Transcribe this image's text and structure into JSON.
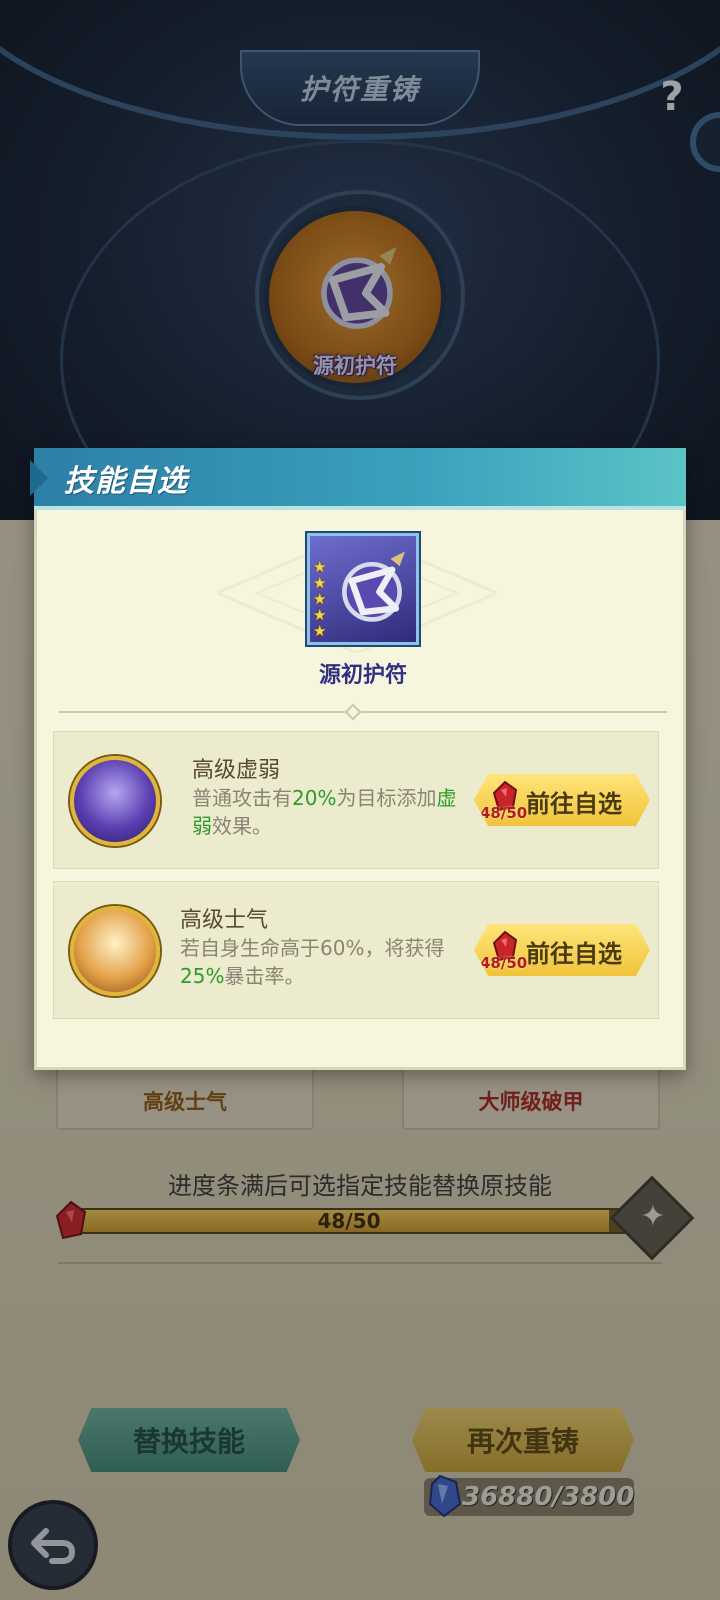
{
  "header": {
    "title": "护符重铸",
    "help_label": "?"
  },
  "amulet": {
    "name": "源初护符"
  },
  "background_cards": {
    "left_label": "高级士气",
    "right_label": "大师级破甲"
  },
  "progress": {
    "caption": "进度条满后可选指定技能替换原技能",
    "current": 48,
    "max": 50,
    "text": "48/50"
  },
  "actions": {
    "replace_label": "替换技能",
    "recast_label": "再次重铸",
    "cost_text": "36880/3800"
  },
  "modal": {
    "title": "技能自选",
    "item_name": "源初护符",
    "item_stars": 5,
    "skills": [
      {
        "name": "高级虚弱",
        "desc_prefix": "普通攻击有",
        "desc_hl1": "20%",
        "desc_mid": "为目标添加",
        "desc_hl2": "虚弱",
        "desc_suffix": "效果。",
        "button_label": "前往自选",
        "count": "48/50"
      },
      {
        "name": "高级士气",
        "desc_prefix": "若自身生命高于60%，将获得",
        "desc_hl1": "25%",
        "desc_suffix": "暴击率。",
        "button_label": "前往自选",
        "count": "48/50"
      }
    ]
  },
  "colors": {
    "modal_header": "#3aa2bc",
    "highlight_green": "#2e9b2a",
    "button_gold": "#f0c43a",
    "button_teal": "#4f9a86",
    "count_red": "#b41a1a"
  }
}
